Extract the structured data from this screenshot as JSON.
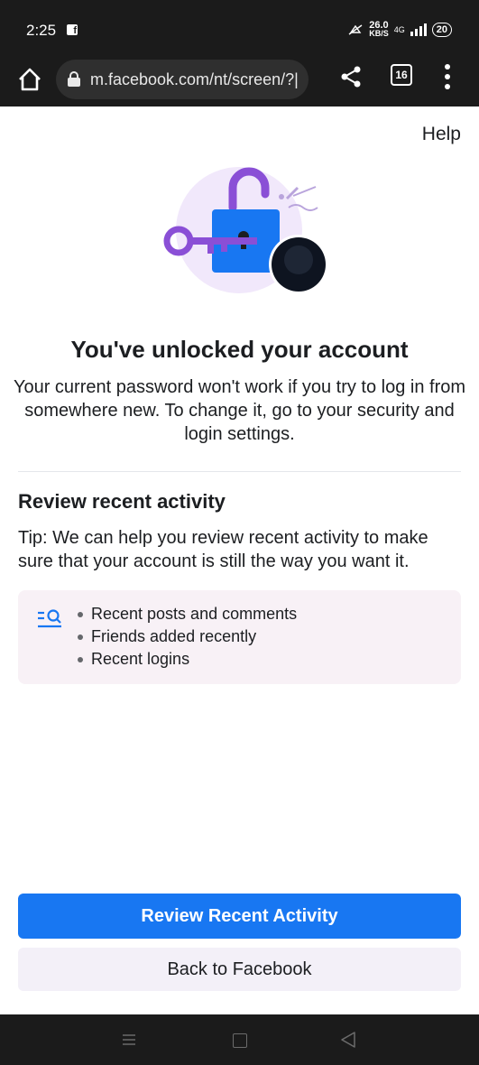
{
  "status_bar": {
    "time": "2:25",
    "fb_icon": "facebook-notification-icon",
    "speed_value": "26.0",
    "speed_unit": "KB/S",
    "network": "4G",
    "battery": "20"
  },
  "browser": {
    "url": "m.facebook.com/nt/screen/?|",
    "tabs_count": "16"
  },
  "page": {
    "help_label": "Help",
    "headline": "You've unlocked your account",
    "subtext": "Your current password won't work if you try to log in from somewhere new. To change it, go to your security and login settings.",
    "section_title": "Review recent activity",
    "tip": "Tip: We can help you review recent activity to make sure that your account is still the way you want it.",
    "activity_items": [
      "Recent posts and comments",
      "Friends added recently",
      "Recent logins"
    ],
    "primary_button": "Review Recent Activity",
    "secondary_button": "Back to Facebook"
  },
  "colors": {
    "accent": "#1877f2",
    "lock_purple": "#8a4fd6",
    "lock_blue": "#1877f2",
    "card_bg": "#f8f1f6"
  }
}
